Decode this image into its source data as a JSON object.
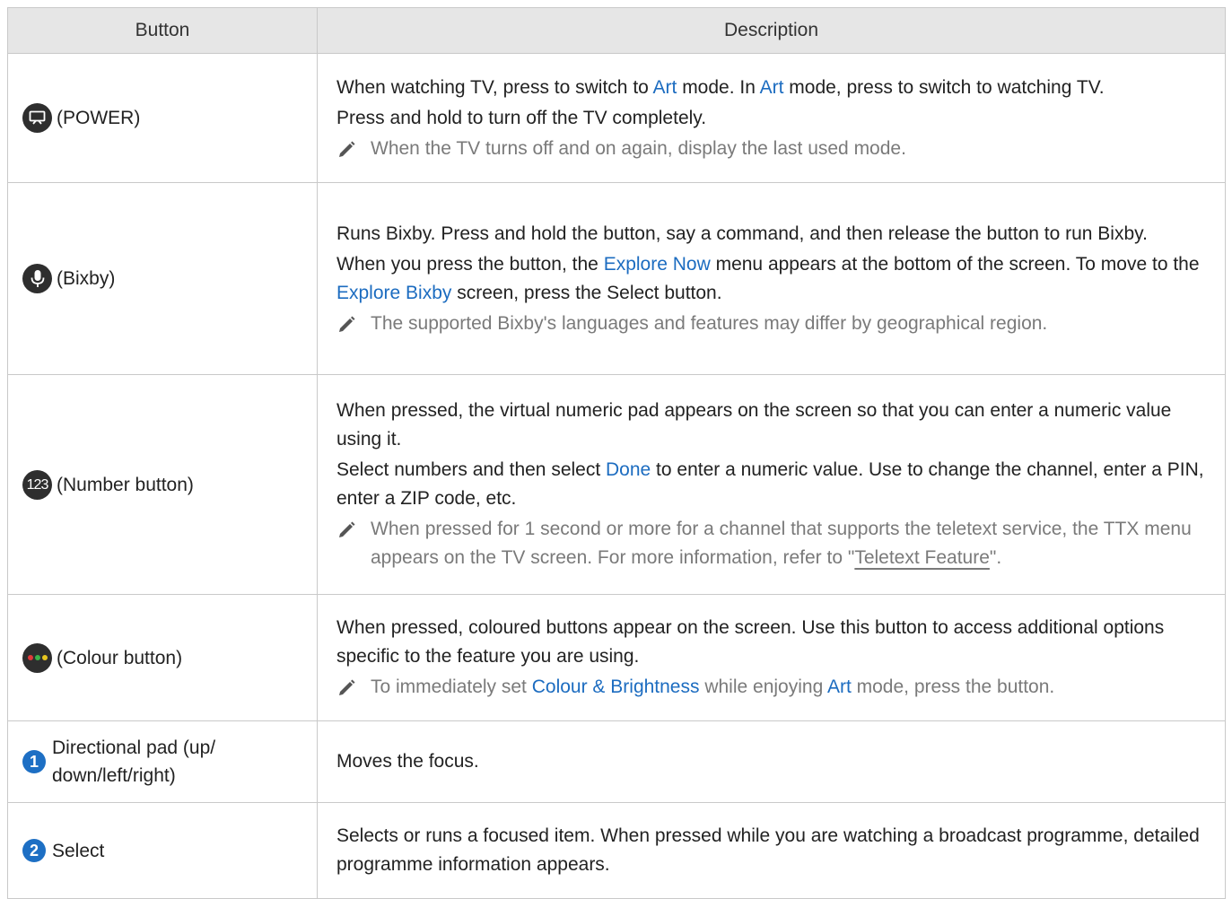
{
  "table": {
    "headers": [
      "Button",
      "Description"
    ],
    "rows": {
      "power": {
        "icon": "power-art-icon",
        "button_label": "(POWER)",
        "line1": {
          "a": "When watching TV, press to switch to ",
          "b": "Art",
          "c": " mode. In ",
          "d": "Art",
          "e": " mode, press to switch to watching TV."
        },
        "line2": "Press and hold to turn off the TV completely.",
        "note": "When the TV turns off and on again, display the last used mode."
      },
      "bixby": {
        "icon": "microphone-icon",
        "button_label": "(Bixby)",
        "line1": "Runs Bixby. Press and hold the button, say a command, and then release the button to run Bixby.",
        "line2": {
          "a": "When you press the button, the ",
          "b": "Explore Now",
          "c": " menu appears at the bottom of the screen. To move to the ",
          "d": "Explore Bixby",
          "e": " screen, press the Select button."
        },
        "note": "The supported Bixby's languages and features may differ by geographical region."
      },
      "number": {
        "icon": "number-123-icon",
        "icon_text": "123",
        "button_label": "(Number button)",
        "line1": "When pressed, the virtual numeric pad appears on the screen so that you can enter a numeric value using it.",
        "line2": {
          "a": "Select numbers and then select ",
          "b": "Done",
          "c": " to enter a numeric value. Use to change the channel, enter a PIN, enter a ZIP code, etc."
        },
        "note": {
          "a": "When pressed for 1 second or more for a channel that supports the teletext service, the TTX menu appears on the TV screen. For more information, refer to \"",
          "b": "Teletext Feature",
          "c": "\"."
        }
      },
      "colour": {
        "icon": "colour-dots-icon",
        "button_label": "(Colour button)",
        "line1": "When pressed, coloured buttons appear on the screen. Use this button to access additional options specific to the feature you are using.",
        "note": {
          "a": "To immediately set ",
          "b": "Colour & Brightness",
          "c": " while enjoying ",
          "d": "Art",
          "e": " mode, press the button."
        }
      },
      "dpad": {
        "badge": "1",
        "button_label": "Directional pad (up/ down/left/right)",
        "line1": "Moves the focus."
      },
      "select": {
        "badge": "2",
        "button_label": "Select",
        "line1": "Selects or runs a focused item. When pressed while you are watching a broadcast programme, detailed programme information appears."
      }
    }
  },
  "colors": {
    "highlight": "#1c6cc0",
    "header_bg": "#e6e6e6",
    "note_text": "#7a7a7a",
    "badge": "#1d6fc4"
  }
}
